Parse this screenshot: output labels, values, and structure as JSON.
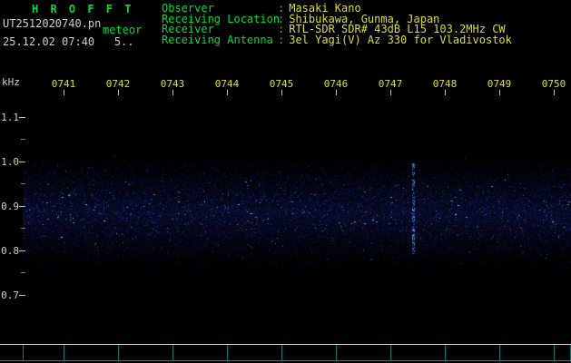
{
  "app": {
    "title": "H R O F F T",
    "filename": "UT2512020740.pn",
    "mode_label": "meteor",
    "datetime_line": "25.12.02 07:40   5.."
  },
  "info": {
    "separator": ":",
    "rows": [
      {
        "label": "Observer",
        "value": "Masaki Kano"
      },
      {
        "label": "Receiving Location",
        "value": "Shibukawa, Gunma, Japan"
      },
      {
        "label": "Receiver",
        "value": "RTL-SDR SDR# 43dB L15 103.2MHz CW"
      },
      {
        "label": "Receiving Antenna",
        "value": "3el Yagi(V) Az 330 for Vladivostok"
      }
    ]
  },
  "chart_data": {
    "type": "heatmap",
    "title": "",
    "xlabel": "",
    "ylabel": "kHz",
    "x_tick_labels": [
      "0741",
      "0742",
      "0743",
      "0744",
      "0745",
      "0746",
      "0747",
      "0748",
      "0749",
      "0750"
    ],
    "y_tick_labels": [
      "1.1",
      "1.0",
      "0.9",
      "0.8",
      "0.7"
    ],
    "y_range_khz": [
      0.6,
      1.15
    ],
    "noise_band_khz": [
      0.78,
      1.0
    ],
    "noise_band_center_khz": 0.89,
    "transient_streak_time": "0747",
    "legend": "off",
    "grid": "off"
  },
  "colors": {
    "background": "#000000",
    "label_green": "#00dd33",
    "value_yellow": "#dddd33",
    "axis_white": "#cccccc",
    "strip_cyan": "#99eeee",
    "noise_blue": "#1e32be",
    "noise_bright": "#4688ff",
    "noise_sparkle": "#8cdcff"
  }
}
